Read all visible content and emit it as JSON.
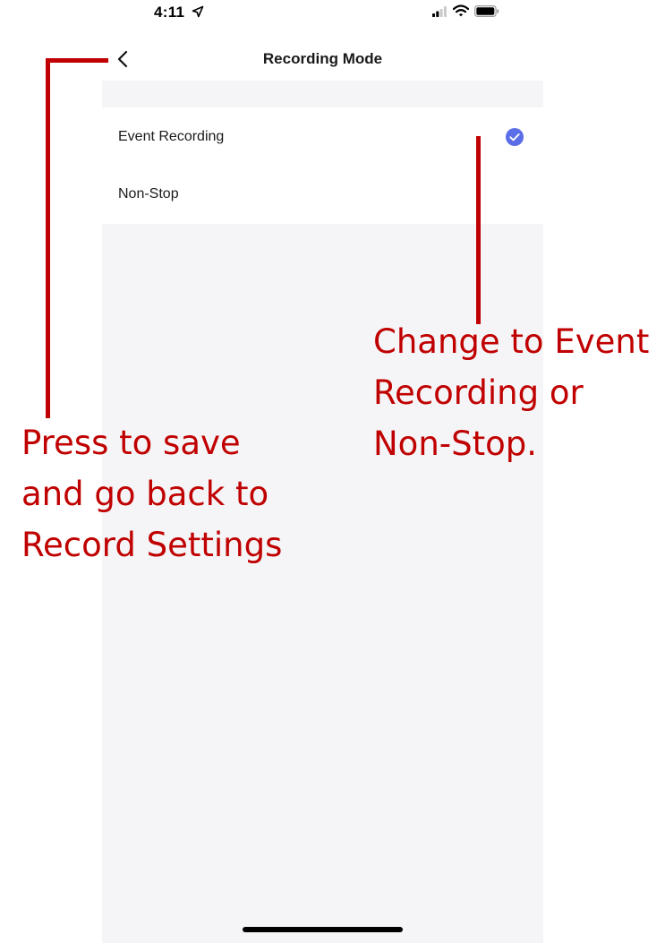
{
  "status_bar": {
    "time": "4:11",
    "icons": [
      "location-arrow-icon",
      "signal-icon",
      "wifi-icon",
      "battery-icon"
    ]
  },
  "nav": {
    "back_icon": "chevron-left-icon",
    "title": "Recording Mode"
  },
  "options": [
    {
      "label": "Event Recording",
      "selected": true
    },
    {
      "label": "Non-Stop",
      "selected": false
    }
  ],
  "colors": {
    "accent": "#5b6ee8",
    "background_gray": "#f5f5f7",
    "annotation": "#c00000"
  },
  "annotations": {
    "back": {
      "lines": [
        "Press to save",
        "and go back to",
        "Record Settings"
      ]
    },
    "mode": {
      "lines": [
        "Change to Event",
        "Recording or",
        "Non-Stop."
      ]
    }
  }
}
